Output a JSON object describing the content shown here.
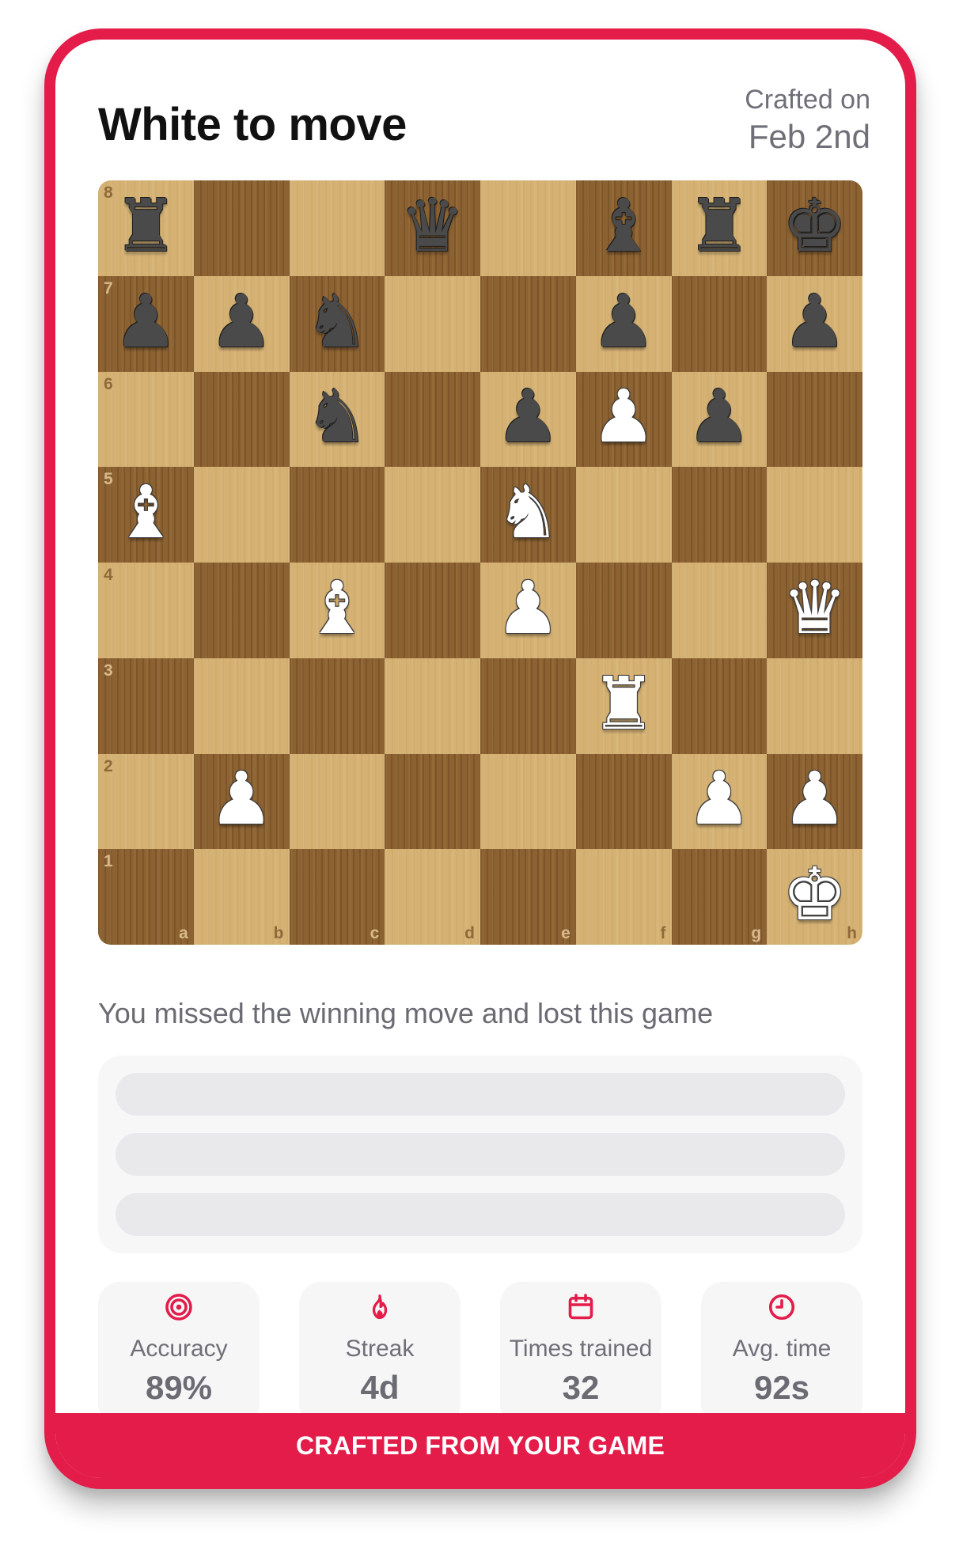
{
  "header": {
    "title": "White to move",
    "crafted_label": "Crafted on",
    "crafted_date": "Feb 2nd"
  },
  "board": {
    "orientation": "white",
    "files": [
      "a",
      "b",
      "c",
      "d",
      "e",
      "f",
      "g",
      "h"
    ],
    "ranks": [
      "8",
      "7",
      "6",
      "5",
      "4",
      "3",
      "2",
      "1"
    ],
    "position": [
      [
        "br",
        "",
        "",
        "bq",
        "",
        "bb",
        "br",
        "bk"
      ],
      [
        "bp",
        "bp",
        "bn",
        "",
        "",
        "bp",
        "",
        "bp"
      ],
      [
        "",
        "",
        "bn",
        "",
        "bp",
        "wp",
        "bp",
        ""
      ],
      [
        "wb",
        "",
        "",
        "",
        "wn",
        "",
        "",
        ""
      ],
      [
        "",
        "",
        "wb",
        "",
        "wp",
        "",
        "",
        "wq"
      ],
      [
        "",
        "",
        "",
        "",
        "",
        "wr",
        "",
        ""
      ],
      [
        "",
        "wp",
        "",
        "",
        "",
        "",
        "wp",
        "wp"
      ],
      [
        "",
        "",
        "",
        "",
        "",
        "",
        "",
        "wk"
      ]
    ],
    "colors": {
      "light_square": "#d5b274",
      "dark_square": "#8c6232"
    }
  },
  "message": "You missed the winning move and lost this game",
  "move_options": {
    "count": 3,
    "state": "loading-placeholder"
  },
  "stats": [
    {
      "icon": "target-icon",
      "label": "Accuracy",
      "value": "89%"
    },
    {
      "icon": "flame-icon",
      "label": "Streak",
      "value": "4d"
    },
    {
      "icon": "calendar-icon",
      "label": "Times trained",
      "value": "32"
    },
    {
      "icon": "clock-icon",
      "label": "Avg. time",
      "value": "92s"
    }
  ],
  "footer": {
    "label": "CRAFTED FROM YOUR GAME"
  },
  "theme": {
    "accent": "#e31c4a",
    "text_dark": "#111111",
    "text_muted": "#6f6f78"
  }
}
